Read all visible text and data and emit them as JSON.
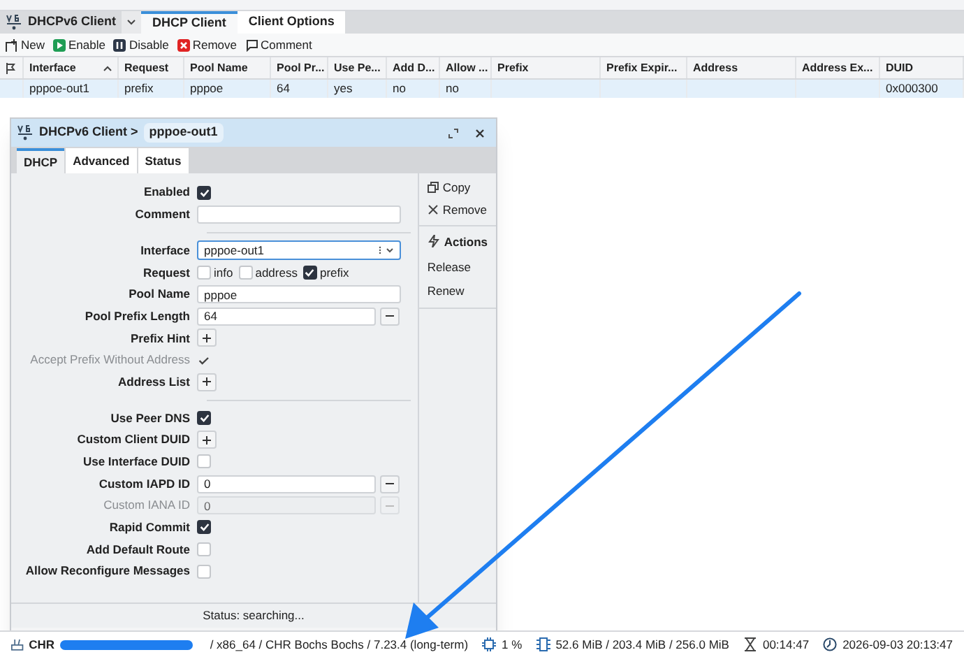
{
  "window": {
    "title": "DHCPv6 Client"
  },
  "tabs": [
    {
      "label": "DHCP Client",
      "selected": true
    },
    {
      "label": "Client Options",
      "selected": false
    }
  ],
  "toolbar": [
    "New",
    "Enable",
    "Disable",
    "Remove",
    "Comment"
  ],
  "table": {
    "columns": [
      "Interface",
      "Request",
      "Pool Name",
      "Pool Pr...",
      "Use Pe...",
      "Add D...",
      "Allow ...",
      "Prefix",
      "Prefix Expir...",
      "Address",
      "Address Ex...",
      "DUID"
    ],
    "rows": [
      {
        "selected": true,
        "cells": [
          "pppoe-out1",
          "prefix",
          "pppoe",
          "64",
          "yes",
          "no",
          "no",
          "",
          "",
          "",
          "",
          "0x000300"
        ]
      }
    ]
  },
  "dialog": {
    "title": "DHCPv6 Client >",
    "record": "pppoe-out1",
    "tabs": [
      {
        "label": "DHCP",
        "selected": true
      },
      {
        "label": "Advanced",
        "selected": false
      },
      {
        "label": "Status",
        "selected": false
      }
    ],
    "fields": [
      {
        "kind": "checkbox",
        "label": "Enabled",
        "checked": true
      },
      {
        "kind": "text",
        "label": "Comment"
      },
      {
        "kind": "divider"
      },
      {
        "kind": "select",
        "label": "Interface",
        "value": "pppoe-out1"
      },
      {
        "kind": "options",
        "label": "Request",
        "options": [
          {
            "label": "info",
            "checked": false
          },
          {
            "label": "address",
            "checked": false
          },
          {
            "label": "prefix",
            "checked": true
          }
        ]
      },
      {
        "kind": "text",
        "label": "Pool Name",
        "value": "pppoe"
      },
      {
        "kind": "text_minus",
        "label": "Pool Prefix Length",
        "value": "64",
        "disabled": false
      },
      {
        "kind": "plus",
        "label": "Prefix Hint"
      },
      {
        "kind": "tick",
        "label": "Accept Prefix Without Address",
        "disabled": true
      },
      {
        "kind": "plus",
        "label": "Address List"
      },
      {
        "kind": "divider"
      },
      {
        "kind": "checkbox",
        "label": "Use Peer DNS",
        "checked": true
      },
      {
        "kind": "plus",
        "label": "Custom Client DUID"
      },
      {
        "kind": "checkbox",
        "label": "Use Interface DUID",
        "checked": false
      },
      {
        "kind": "text_minus",
        "label": "Custom IAPD ID",
        "value": "0",
        "disabled": false
      },
      {
        "kind": "text_minus",
        "label": "Custom IANA ID",
        "value": "0",
        "disabled": true
      },
      {
        "kind": "checkbox",
        "label": "Rapid Commit",
        "checked": true
      },
      {
        "kind": "checkbox",
        "label": "Add Default Route",
        "checked": false
      },
      {
        "kind": "checkbox",
        "label": "Allow Reconfigure Messages",
        "checked": false
      }
    ],
    "side_actions": [
      "Copy",
      "Remove"
    ],
    "actions_heading": "Actions",
    "actions": [
      "Release",
      "Renew"
    ],
    "status": "Status: searching..."
  },
  "status_bar": {
    "system": "CHR",
    "version": "/ x86_64 / CHR Bochs Bochs / 7.23.4 (long-term)",
    "cpu": "1 %",
    "memory": "52.6 MiB / 203.4 MiB / 256.0 MiB",
    "uptime": "00:14:47",
    "clock": "2026-09-03 20:13:47"
  }
}
